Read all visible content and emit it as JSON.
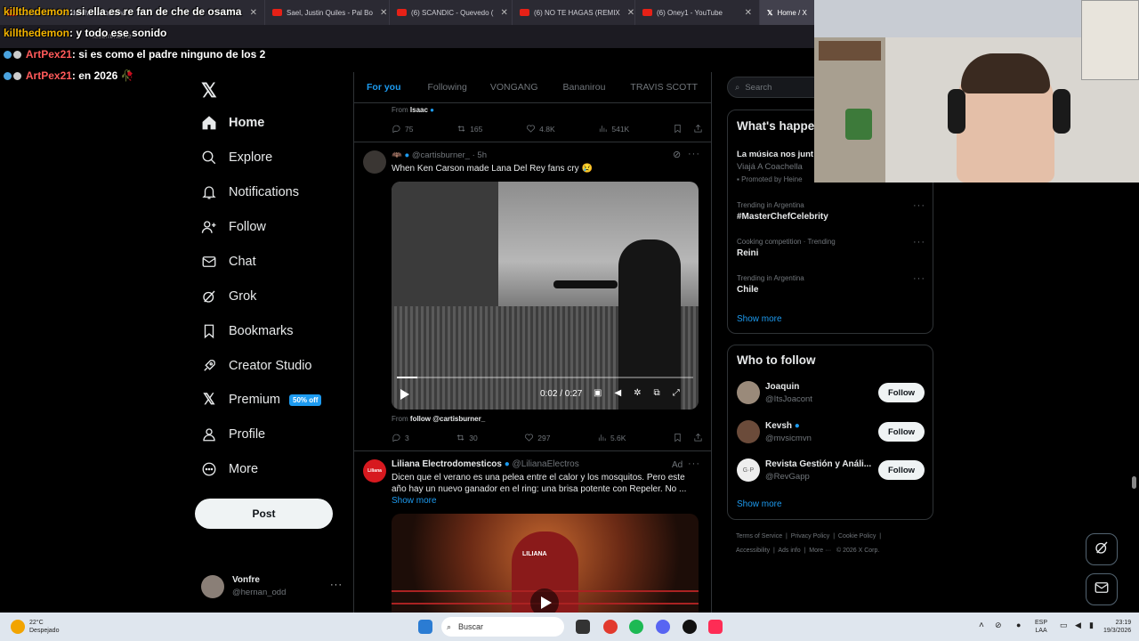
{
  "browser": {
    "tabs": [
      {
        "title": "si ella es re fan de che de osama",
        "active": false
      },
      {
        "title": "Sael, Justin Quiles - Pal Bo",
        "active": false
      },
      {
        "title": "(6) SCANDIC - Quevedo (",
        "active": false
      },
      {
        "title": "(6) NO TE HAGAS (REMIX",
        "active": false
      },
      {
        "title": "(6) Oney1 - YouTube",
        "active": false
      },
      {
        "title": "Home / X",
        "active": true
      }
    ],
    "url": "x.com/home"
  },
  "stream_chat": [
    {
      "user": "killthedemon",
      "message": ": si ella es re fan de che de osama"
    },
    {
      "user": "killthedemon",
      "message": ": y todo ese sonido"
    },
    {
      "user": "ArtPex21",
      "message": ": si es como el padre ninguno de los 2"
    },
    {
      "user": "ArtPex21",
      "message": ": en 2026 🥀"
    }
  ],
  "sidebar": {
    "logo": "X",
    "items": [
      {
        "label": "Home",
        "icon": "home-icon"
      },
      {
        "label": "Explore",
        "icon": "search-icon"
      },
      {
        "label": "Notifications",
        "icon": "bell-icon"
      },
      {
        "label": "Follow",
        "icon": "person-add-icon"
      },
      {
        "label": "Chat",
        "icon": "mail-icon"
      },
      {
        "label": "Grok",
        "icon": "grok-icon"
      },
      {
        "label": "Bookmarks",
        "icon": "bookmark-icon"
      },
      {
        "label": "Creator Studio",
        "icon": "rocket-icon"
      },
      {
        "label": "Premium",
        "icon": "x-logo-icon"
      },
      {
        "label": "Profile",
        "icon": "person-icon"
      },
      {
        "label": "More",
        "icon": "more-circle-icon"
      }
    ],
    "premium_badge": "50% off",
    "post_label": "Post",
    "account": {
      "name": "Vonfre",
      "handle": "@hernan_odd",
      "more": "···"
    }
  },
  "feed": {
    "tabs": [
      "For you",
      "Following",
      "VONGANG",
      "Bananirou",
      "TRAVIS SCOTT"
    ],
    "active_tab": "For you",
    "prev_post": {
      "from_prefix": "From",
      "from_name": "Isaac",
      "replies": "75",
      "reposts": "165",
      "likes": "4.8K",
      "views": "541K"
    },
    "post": {
      "author_handle": "@cartisburner_",
      "time": "· 5h",
      "text": "When Ken Carson made Lana Del Rey fans cry 😢",
      "video_time": "0:02 / 0:27",
      "video_progress": 0.07,
      "from_prefix": "From",
      "from_text": "follow @cartisburner_",
      "replies": "3",
      "reposts": "30",
      "likes": "297",
      "views": "5.6K"
    },
    "ad": {
      "author": "Liliana Electrodomesticos",
      "handle": "@LilianaElectros",
      "ad_label": "Ad",
      "text": "Dicen que el verano es una pelea entre el calor y los mosquitos. Pero este año hay un nuevo ganador en el ring: una brisa potente con Repeler. No ...",
      "show_more": "Show more",
      "avatar_text": "Liliana",
      "robe_text": "LILIANA"
    }
  },
  "right": {
    "search_placeholder": "Search",
    "happening": {
      "title": "What's happe",
      "promo_title": "La música nos junt",
      "promo_sub": "Viajá A Coachella",
      "promo_by": "Promoted by Heine",
      "trends": [
        {
          "context": "Trending in Argentina",
          "name": "#MasterChefCelebrity"
        },
        {
          "context": "Cooking competition · Trending",
          "name": "Reini"
        },
        {
          "context": "Trending in Argentina",
          "name": "Chile"
        }
      ],
      "show_more": "Show more"
    },
    "who_to_follow": {
      "title": "Who to follow",
      "users": [
        {
          "name": "Joaquin",
          "handle": "@ItsJoacont",
          "button": "Follow"
        },
        {
          "name": "Kevsh",
          "handle": "@mvsicmvn",
          "button": "Follow"
        },
        {
          "name": "Revista Gestión y Análi...",
          "handle": "@RevGapp",
          "button": "Follow"
        }
      ],
      "show_more": "Show more"
    },
    "footer": {
      "links": [
        "Terms of Service",
        "Privacy Policy",
        "Cookie Policy",
        "Accessibility",
        "Ads info",
        "More ···"
      ],
      "copyright": "© 2026 X Corp."
    }
  },
  "taskbar": {
    "weather_temp": "22°C",
    "weather_desc": "Despejado",
    "search_label": "Buscar",
    "lang_top": "ESP",
    "lang_bottom": "LAA",
    "time": "23:19",
    "date": "19/3/2026"
  },
  "colors": {
    "accent": "#1d9bf0",
    "background": "#000000",
    "border": "#2f3336",
    "muted": "#71767b"
  }
}
